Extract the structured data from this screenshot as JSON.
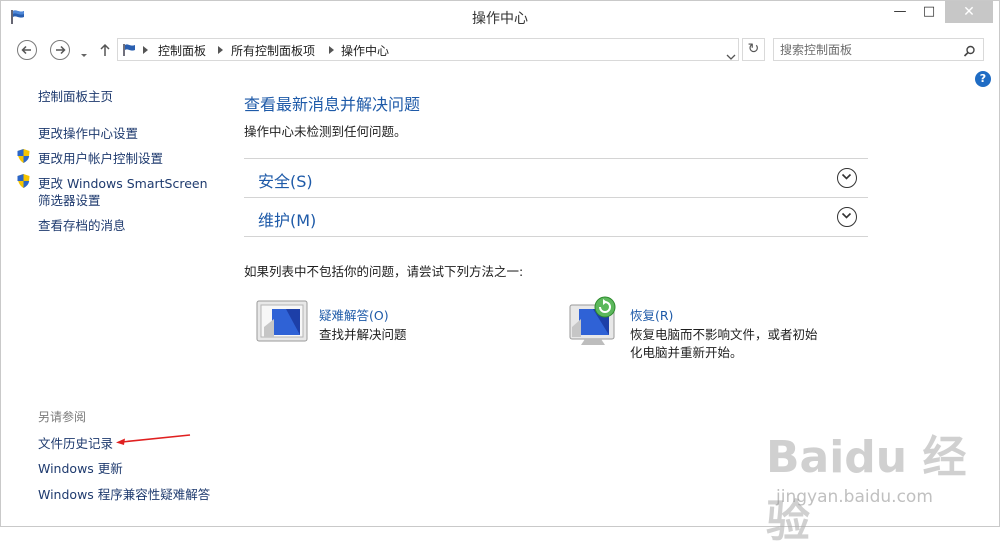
{
  "window": {
    "title": "操作中心",
    "min_label": "—",
    "max_label": "□",
    "close_label": "✕"
  },
  "nav": {
    "breadcrumbs": [
      "控制面板",
      "所有控制面板项",
      "操作中心"
    ],
    "refresh_label": "↻",
    "search_placeholder": "搜索控制面板",
    "help_label": "?"
  },
  "left_pane": {
    "home": "控制面板主页",
    "links": [
      {
        "label": "更改操作中心设置",
        "shield": false
      },
      {
        "label": "更改用户帐户控制设置",
        "shield": true
      },
      {
        "label": "更改 Windows SmartScreen",
        "label2": "筛选器设置",
        "shield": true
      },
      {
        "label": "查看存档的消息",
        "shield": false
      }
    ],
    "see_also_heading": "另请参阅",
    "see_also": [
      "文件历史记录",
      "Windows 更新",
      "Windows 程序兼容性疑难解答"
    ]
  },
  "main": {
    "title": "查看最新消息并解决问题",
    "subtitle": "操作中心未检测到任何问题。",
    "sections": [
      {
        "label": "安全(S)"
      },
      {
        "label": "维护(M)"
      }
    ],
    "try_text": "如果列表中不包括你的问题，请尝试下列方法之一:",
    "options": [
      {
        "link": "疑难解答(O)",
        "desc": "查找并解决问题",
        "icon": "troubleshoot-monitor-icon"
      },
      {
        "link": "恢复(R)",
        "desc_line1": "恢复电脑而不影响文件，或者初始",
        "desc_line2": "化电脑并重新开始。",
        "icon": "recovery-monitor-icon"
      }
    ]
  },
  "watermark": {
    "brand": "Baidu 经验",
    "url": "jingyan.baidu.com"
  },
  "colors": {
    "link": "#1e5aa8",
    "annotation_arrow": "#e02020",
    "close_button": "#c7c7c7"
  }
}
